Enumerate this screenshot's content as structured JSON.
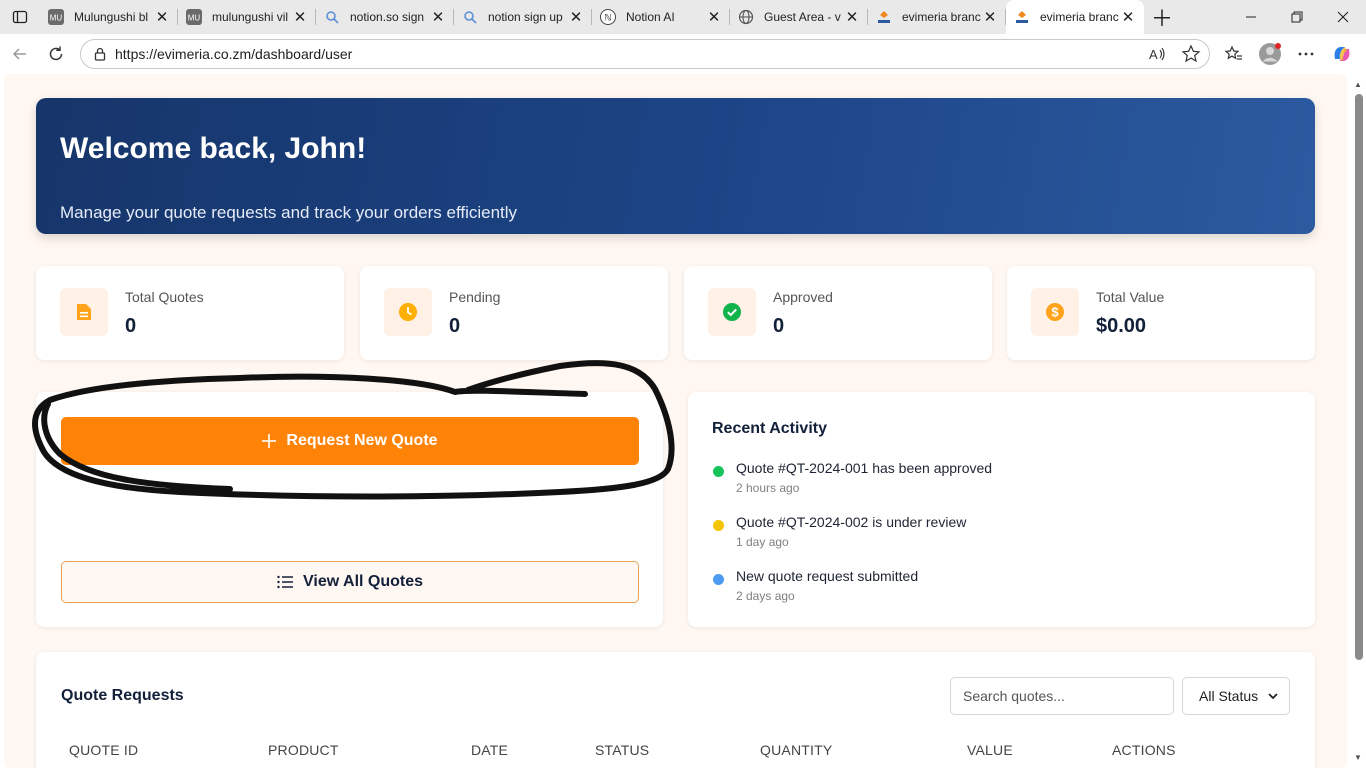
{
  "browser": {
    "tabs": [
      {
        "label": "Mulungushi bl",
        "icon": "mu-site-icon",
        "active": false
      },
      {
        "label": "mulungushi vil",
        "icon": "mu-site-icon",
        "active": false
      },
      {
        "label": "notion.so sign",
        "icon": "search-icon",
        "active": false
      },
      {
        "label": "notion sign up",
        "icon": "search-icon",
        "active": false
      },
      {
        "label": "Notion AI",
        "icon": "notion-icon",
        "active": false
      },
      {
        "label": "Guest Area - v",
        "icon": "globe-icon",
        "active": false
      },
      {
        "label": "evimeria branc",
        "icon": "evimeria-icon",
        "active": false
      },
      {
        "label": "evimeria branc",
        "icon": "evimeria-icon",
        "active": true
      }
    ],
    "url": "https://evimeria.co.zm/dashboard/user"
  },
  "hero": {
    "title": "Welcome back, John!",
    "subtitle": "Manage your quote requests and track your orders efficiently"
  },
  "stats": [
    {
      "label": "Total Quotes",
      "value": "0",
      "icon": "document-icon",
      "color": "#ffa31a"
    },
    {
      "label": "Pending",
      "value": "0",
      "icon": "clock-icon",
      "color": "#ffb000"
    },
    {
      "label": "Approved",
      "value": "0",
      "icon": "check-circle-icon",
      "color": "#11b34b"
    },
    {
      "label": "Total Value",
      "value": "$0.00",
      "icon": "dollar-icon",
      "color": "#ffa31a"
    }
  ],
  "actions": {
    "request_label": "Request New Quote",
    "view_all_label": "View All Quotes"
  },
  "recent_activity": {
    "title": "Recent Activity",
    "items": [
      {
        "text": "Quote #QT-2024-001 has been approved",
        "time": "2 hours ago",
        "color": "#16c45a"
      },
      {
        "text": "Quote #QT-2024-002 is under review",
        "time": "1 day ago",
        "color": "#f5c400"
      },
      {
        "text": "New quote request submitted",
        "time": "2 days ago",
        "color": "#4d9bf0"
      }
    ]
  },
  "quotes": {
    "title": "Quote Requests",
    "search_placeholder": "Search quotes...",
    "status_filter": "All Status",
    "columns": [
      "QUOTE ID",
      "PRODUCT",
      "DATE",
      "STATUS",
      "QUANTITY",
      "VALUE",
      "ACTIONS"
    ]
  },
  "colors": {
    "accent": "#ff8306",
    "hero_dark": "#16356a",
    "text_dark": "#13203a"
  }
}
